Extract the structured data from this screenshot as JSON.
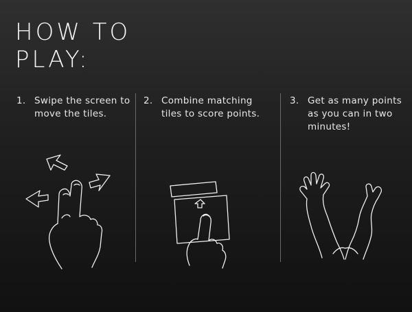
{
  "title": "HOW TO\nPLAY:",
  "steps": [
    {
      "number": "1.",
      "text": "Swipe the screen to move the tiles."
    },
    {
      "number": "2.",
      "text": "Combine matching tiles to score points."
    },
    {
      "number": "3.",
      "text": "Get as many points as you can in two minutes!"
    }
  ],
  "illustrations": {
    "step1": "swipe-hand-icon",
    "step2": "tap-tile-hand-icon",
    "step3": "raised-arms-icon"
  },
  "colors": {
    "background_top": "#2f2f2f",
    "background_bottom": "#111111",
    "text": "#f2f2f2",
    "divider": "#6a6a6a"
  }
}
